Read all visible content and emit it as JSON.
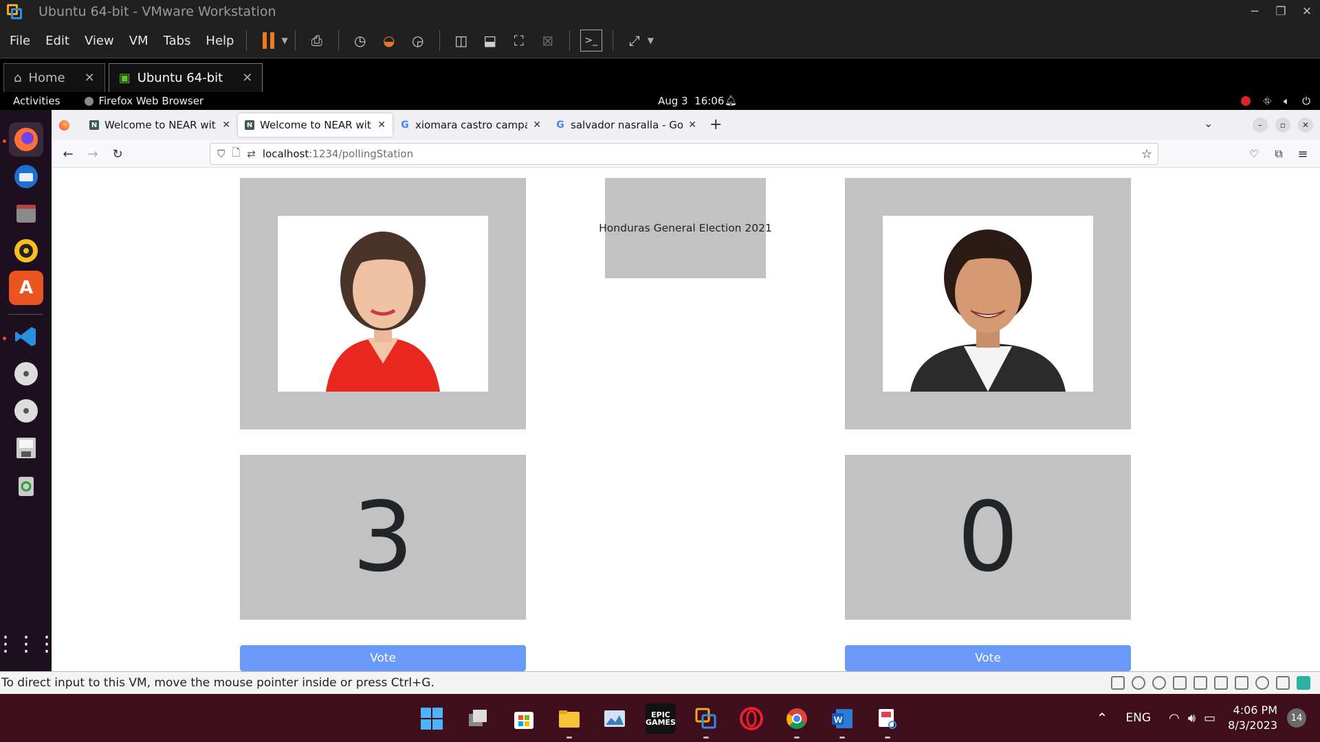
{
  "vmware": {
    "title": "Ubuntu 64-bit - VMware Workstation",
    "menus": [
      "File",
      "Edit",
      "View",
      "VM",
      "Tabs",
      "Help"
    ],
    "tabs": [
      {
        "label": "Home",
        "active": false
      },
      {
        "label": "Ubuntu 64-bit",
        "active": true
      }
    ],
    "status_message": "To direct input to this VM, move the mouse pointer inside or press Ctrl+G."
  },
  "ubuntu": {
    "activities": "Activities",
    "app_name": "Firefox Web Browser",
    "date": "Aug 3",
    "time": "16:06"
  },
  "firefox": {
    "tabs": [
      {
        "title": "Welcome to NEAR with R",
        "favicon": "N",
        "active": false
      },
      {
        "title": "Welcome to NEAR with R",
        "favicon": "N",
        "active": true
      },
      {
        "title": "xiomara castro campaña",
        "favicon": "G",
        "active": false
      },
      {
        "title": "salvador nasralla - Googl",
        "favicon": "G",
        "active": false
      }
    ],
    "url_host": "localhost",
    "url_path": ":1234/pollingStation"
  },
  "page": {
    "election_title": "Honduras General Election 2021",
    "candidates": [
      {
        "count": "3",
        "vote_label": "Vote"
      },
      {
        "count": "0",
        "vote_label": "Vote"
      }
    ]
  },
  "taskbar": {
    "language": "ENG",
    "time": "4:06 PM",
    "date": "8/3/2023",
    "notifications": "14"
  },
  "colors": {
    "card_bg": "#c2c2c2",
    "vote_button": "#6a9af9",
    "taskbar_bg": "#3f0e1c",
    "dock_bg": "#1d0f1f"
  }
}
